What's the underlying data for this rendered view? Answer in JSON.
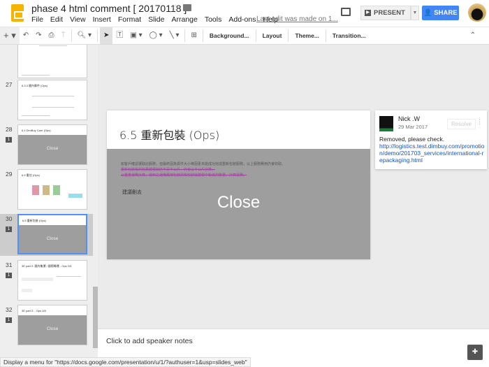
{
  "header": {
    "title": "phase 4 html comment [ 20170118 ]",
    "menu": [
      "File",
      "Edit",
      "View",
      "Insert",
      "Format",
      "Slide",
      "Arrange",
      "Tools",
      "Add-ons",
      "Help"
    ],
    "last_edit": "Last edit was made on 1...",
    "present": "PRESENT",
    "share": "SHARE"
  },
  "toolbar": {
    "background": "Background...",
    "layout": "Layout",
    "theme": "Theme...",
    "transition": "Transition..."
  },
  "filmstrip": {
    "slides": [
      {
        "num": "27",
        "title": "6.3.3 國內郵件 (Ops)",
        "comments": "",
        "closed": false
      },
      {
        "num": "28",
        "title": "6.4 DimBuy Care (Ops)",
        "comments": "1",
        "closed": true,
        "close": "Close"
      },
      {
        "num": "29",
        "title": "6.5 重估 (Ops)",
        "comments": "",
        "closed": false
      },
      {
        "num": "30",
        "title": "6.5 重新包裝 (Ops)",
        "comments": "1",
        "closed": true,
        "close": "Close",
        "selected": true
      },
      {
        "num": "31",
        "title": "3E part 2: 國內集運 / 國際轉運 - Ops 2/5",
        "comments": "1",
        "closed": false
      },
      {
        "num": "32",
        "title": "3E part 2: - Ops 4/5",
        "comments": "1",
        "closed": true,
        "close": "Close"
      }
    ]
  },
  "slide": {
    "title": "6.5 重新包裝 (Ops)",
    "bullets": [
      "如客戶確認選取此服務，但最終因為貨件大小等因素未能成功完成重新包裝服務，以上服務費用仍會收取。",
      "重新包裝後的包裹體積如仍不足半公斤，仍會以半公斤計算。",
      "以重量運費計算，運到之運費再按包裝前和包裝後體積中較低的數量，計算運費。"
    ],
    "suggest": "建議刪去",
    "close": "Close"
  },
  "comment": {
    "author": "Nick .W",
    "date": "29 Mar 2017",
    "resolve": "Resolve",
    "text": "Removed, please check.",
    "link": "http://logistics.test.dimbuy.com/promotion/demo/201703_services/international-repackaging.html"
  },
  "notes": {
    "placeholder": "Click to add speaker notes"
  },
  "status": "Display a menu for \"https://docs.google.com/presentation/u/1/?authuser=1&usp=slides_web\"",
  "colors": {
    "share": "#4285f4",
    "overlay": "#9e9e9e",
    "link": "#1155cc",
    "logo": "#f4b400"
  }
}
